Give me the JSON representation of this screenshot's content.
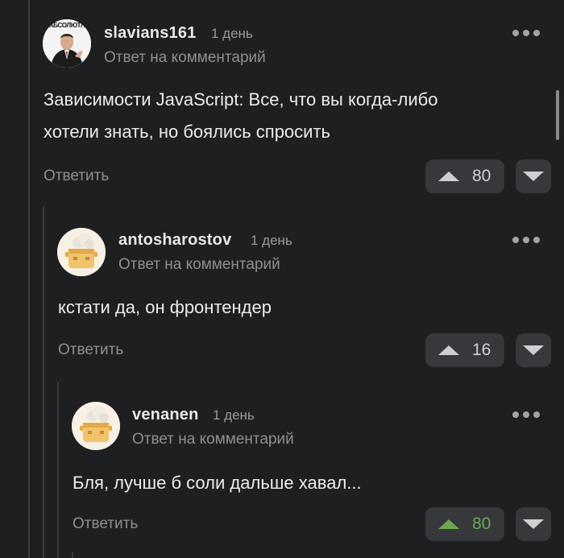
{
  "comments": [
    {
      "username": "slavians161",
      "time": "1 день",
      "reply_to": "Ответ на комментарий",
      "text_line1": "Зависимости JavaScript: Все, что вы когда-либо",
      "text_line2": "хотели знать, но боялись спросить",
      "reply_label": "Ответить",
      "votes": "80",
      "avatar_caption": "АБСОЛЮТЛ",
      "avatar_icon": "man-in-suit-avatar",
      "upvoted": false
    },
    {
      "username": "antosharostov",
      "time": "1 день",
      "reply_to": "Ответ на комментарий",
      "text_line1": "кстати да, он фронтендер",
      "reply_label": "Ответить",
      "votes": "16",
      "avatar_icon": "cooking-pot-avatar",
      "upvoted": false
    },
    {
      "username": "venanen",
      "time": "1 день",
      "reply_to": "Ответ на комментарий",
      "text_line1": "Бля, лучше б соли дальше хавал...",
      "reply_label": "Ответить",
      "votes": "80",
      "avatar_icon": "cooking-pot-avatar",
      "upvoted": true
    }
  ],
  "colors": {
    "background": "#1e1f21",
    "button_bg": "#37383b",
    "upvote_active": "#6aa84f",
    "muted_text": "#8e8f92"
  }
}
